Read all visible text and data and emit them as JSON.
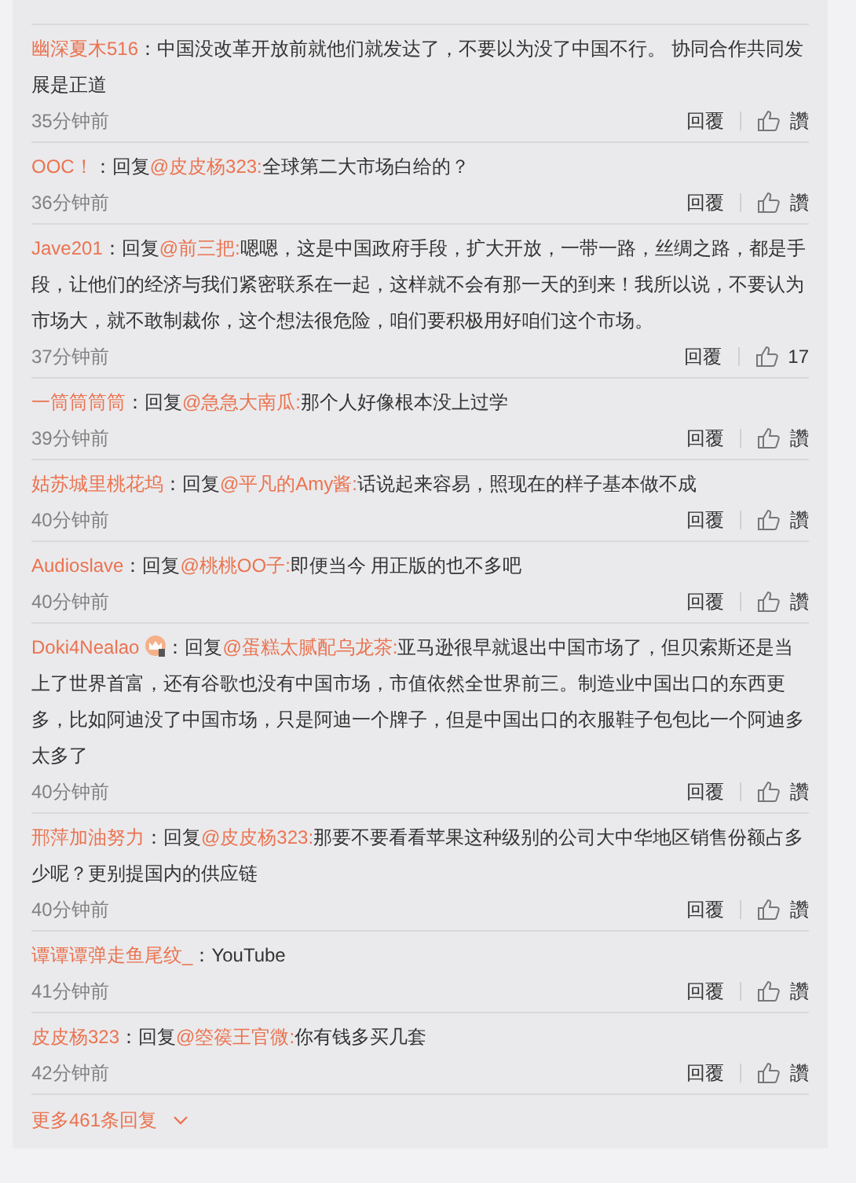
{
  "comments": [
    {
      "user": "幽深夏木516",
      "badge": false,
      "prefix": "：",
      "text": "中国没改革开放前就他们就发达了，不要以为没了中国不行。 协同合作共同发展是正道",
      "time": "35分钟前",
      "reply": "回覆",
      "like": "讚"
    },
    {
      "user": "OOC！",
      "badge": false,
      "prefix": "：回复",
      "mention": "@皮皮杨323:",
      "text": "全球第二大市场白给的？",
      "time": "36分钟前",
      "reply": "回覆",
      "like": "讚"
    },
    {
      "user": "Jave201",
      "badge": false,
      "prefix": "：回复",
      "mention": "@前三把:",
      "text": "嗯嗯，这是中国政府手段，扩大开放，一带一路，丝绸之路，都是手段，让他们的经济与我们紧密联系在一起，这样就不会有那一天的到来！我所以说，不要认为市场大，就不敢制裁你，这个想法很危险，咱们要积极用好咱们这个市场。",
      "time": "37分钟前",
      "reply": "回覆",
      "like": "17"
    },
    {
      "user": "一筒筒筒筒",
      "badge": false,
      "prefix": "：回复",
      "mention": "@急急大南瓜:",
      "text": "那个人好像根本没上过学",
      "time": "39分钟前",
      "reply": "回覆",
      "like": "讚"
    },
    {
      "user": "姑苏城里桃花坞",
      "badge": false,
      "prefix": "：回复",
      "mention": "@平凡的Amy酱:",
      "text": "话说起来容易，照现在的样子基本做不成",
      "time": "40分钟前",
      "reply": "回覆",
      "like": "讚"
    },
    {
      "user": "Audioslave",
      "badge": false,
      "prefix": "：回复",
      "mention": "@桃桃OO子:",
      "text": "即便当今 用正版的也不多吧",
      "time": "40分钟前",
      "reply": "回覆",
      "like": "讚"
    },
    {
      "user": "Doki4Nealao",
      "badge": true,
      "prefix": "：回复",
      "mention": "@蛋糕太腻配乌龙茶:",
      "text": "亚马逊很早就退出中国市场了，但贝索斯还是当上了世界首富，还有谷歌也没有中国市场，市值依然全世界前三。制造业中国出口的东西更多，比如阿迪没了中国市场，只是阿迪一个牌子，但是中国出口的衣服鞋子包包比一个阿迪多太多了",
      "time": "40分钟前",
      "reply": "回覆",
      "like": "讚"
    },
    {
      "user": "邢萍加油努力",
      "badge": false,
      "prefix": "：回复",
      "mention": "@皮皮杨323:",
      "text": "那要不要看看苹果这种级别的公司大中华地区销售份额占多少呢？更别提国内的供应链",
      "time": "40分钟前",
      "reply": "回覆",
      "like": "讚"
    },
    {
      "user": "谭谭谭弹走鱼尾纹_",
      "badge": false,
      "prefix": "：",
      "text": "YouTube",
      "time": "41分钟前",
      "reply": "回覆",
      "like": "讚"
    },
    {
      "user": "皮皮杨323",
      "badge": false,
      "prefix": "：回复",
      "mention": "@箜篌王官微:",
      "text": "你有钱多买几套",
      "time": "42分钟前",
      "reply": "回覆",
      "like": "讚"
    }
  ],
  "more": "更多461条回复"
}
